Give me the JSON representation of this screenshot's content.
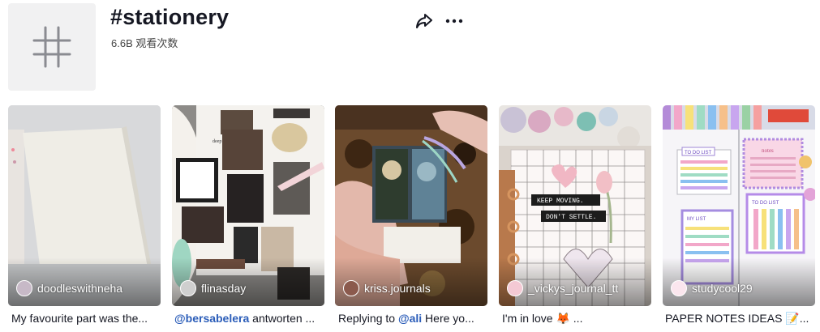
{
  "tag": {
    "title": "#stationery",
    "views": "6.6B 观看次数"
  },
  "header_actions": {
    "share_icon": "share-arrow-icon",
    "more_icon": "ellipsis-icon"
  },
  "videos": [
    {
      "username": "doodleswithneha",
      "caption": "My favourite part was the..."
    },
    {
      "username": "flinasday",
      "mention": "@bersabelera",
      "caption": " antworten ..."
    },
    {
      "username": "kriss.journals",
      "caption_prefix": "Replying to ",
      "mention": "@ali",
      "caption": " Here yo..."
    },
    {
      "username": "_vickys_journal_tt",
      "caption": "I'm in love 🦊 ..."
    },
    {
      "username": "studycool29",
      "caption": "PAPER NOTES IDEAS 📝..."
    }
  ],
  "thumb_texts": {
    "v2_snippet": "deep springs of life",
    "v4_label1": "KEEP MOVING.",
    "v4_label2": "DON'T SETTLE.",
    "v5_list1": "TO DO LIST",
    "v5_list2": "TO DO LIST",
    "v5_list3": "MY LIST",
    "v5_notes": "notes"
  }
}
